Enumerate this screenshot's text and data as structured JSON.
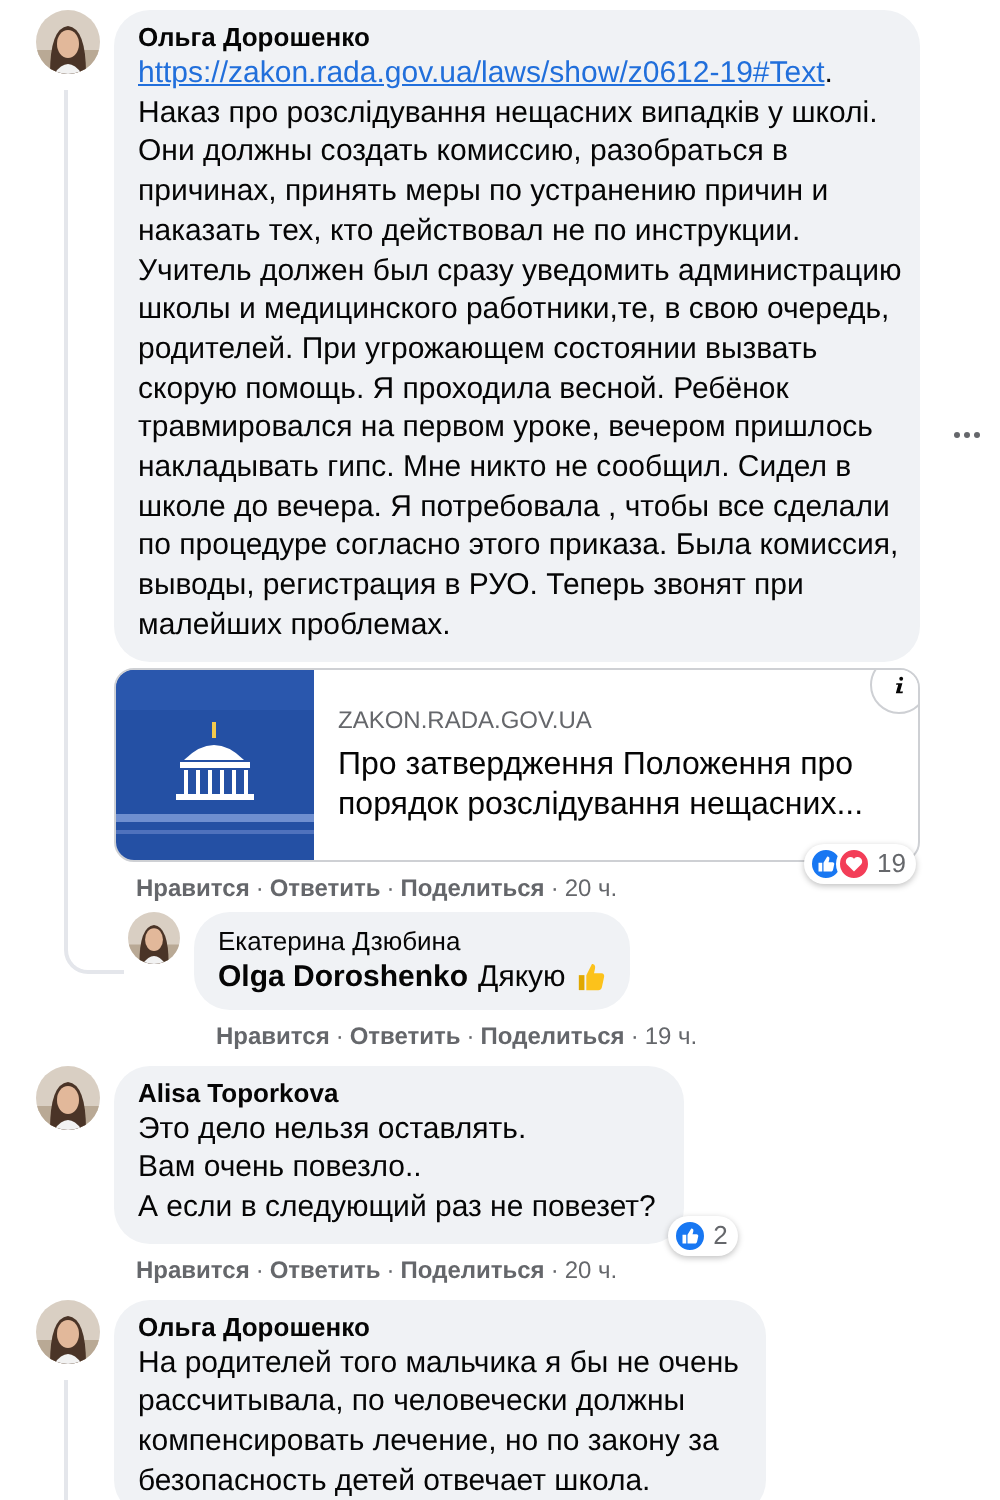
{
  "comments": [
    {
      "author": "Ольга Дорошенко",
      "thread_line": true,
      "link": "https://zakon.rada.gov.ua/laws/show/z0612-19#Text",
      "link_suffix": ".",
      "text": "Наказ про розслідування нещасних випадків у школі.\nОни должны создать комиссию, разобраться в\nпричинах, принять меры по устранению причин и\nнаказать тех, кто действовал не по инструкции.\nУчитель должен был сразу уведомить администрацию\nшколы и медицинского работники,те, в свою очередь,\nродителей. При угрожающем состоянии вызвать\nскорую помощь. Я проходила весной. Ребёнок\nтравмировался на первом уроке, вечером пришлось\nнакладывать гипс. Мне никто не сообщил. Сидел в\nшколе до вечера. Я потребовала , чтобы все сделали\nпо процедуре согласно этого приказа. Была комиссия,\nвыводы, регистрация в РУО. Теперь звонят при\nмалейших проблемах.",
      "more_button": true,
      "link_preview": {
        "kind": "picture",
        "domain": "ZAKON.RADA.GOV.UA",
        "title": "Про затвердження Положення про\nпорядок розслідування нещасних..."
      },
      "reactions": {
        "icons": [
          {
            "kind": "like"
          },
          {
            "kind": "love"
          }
        ],
        "count": "19"
      },
      "footer": [
        {
          "kind": "action",
          "text": "Нравится"
        },
        {
          "kind": "sep",
          "text": "·"
        },
        {
          "kind": "action",
          "text": "Ответить"
        },
        {
          "kind": "sep",
          "text": "·"
        },
        {
          "kind": "action",
          "text": "Поделиться"
        },
        {
          "kind": "sep",
          "text": "·"
        },
        {
          "kind": "time",
          "text": "20 ч."
        }
      ],
      "replies": [
        {
          "author": "Екатерина Дзюбина",
          "mention": "Olga Doroshenko",
          "text": "Дякую",
          "trailing_icon": {
            "kind": "thumbs_up"
          },
          "footer": [
            {
              "kind": "action",
              "text": "Нравится"
            },
            {
              "kind": "sep",
              "text": "·"
            },
            {
              "kind": "action",
              "text": "Ответить"
            },
            {
              "kind": "sep",
              "text": "·"
            },
            {
              "kind": "action",
              "text": "Поделиться"
            },
            {
              "kind": "sep",
              "text": "·"
            },
            {
              "kind": "time",
              "text": "19 ч."
            }
          ]
        }
      ]
    },
    {
      "author": "Alisa Toporkova",
      "thread_line": false,
      "text": "Это дело нельзя оставлять.\nВам очень повезло..\nА если в следующий раз не повезет?",
      "reactions": {
        "icons": [
          {
            "kind": "like"
          }
        ],
        "count": "2"
      },
      "footer": [
        {
          "kind": "action",
          "text": "Нравится"
        },
        {
          "kind": "sep",
          "text": "·"
        },
        {
          "kind": "action",
          "text": "Ответить"
        },
        {
          "kind": "sep",
          "text": "·"
        },
        {
          "kind": "action",
          "text": "Поделиться"
        },
        {
          "kind": "sep",
          "text": "·"
        },
        {
          "kind": "time",
          "text": "20 ч."
        }
      ]
    },
    {
      "author": "Ольга Дорошенко",
      "thread_line": true,
      "text": "На родителей того мальчика я бы не очень\nрассчитывала, по человечески должны\nкомпенсировать лечение, но по закону за\nбезопасность детей отвечает школа."
    }
  ]
}
